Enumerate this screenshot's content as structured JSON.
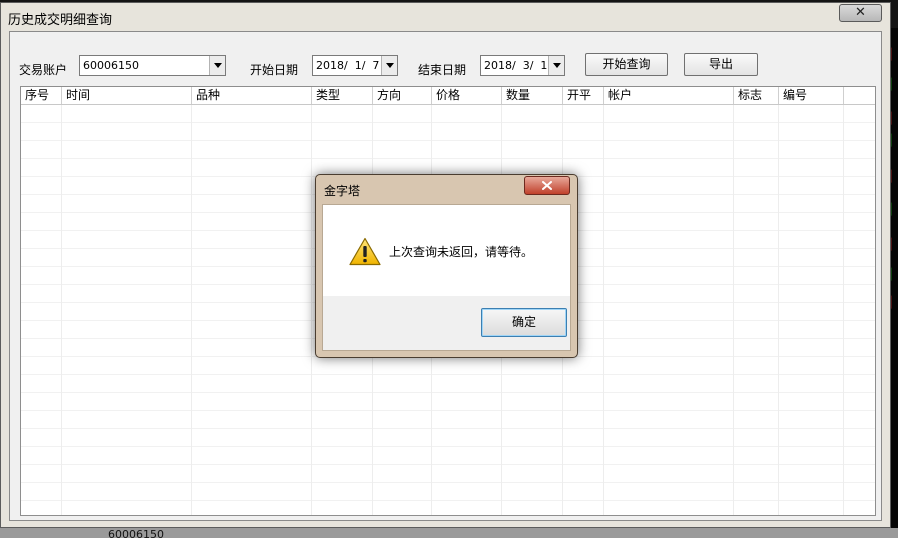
{
  "window": {
    "title": "历史成交明细查询",
    "close_glyph": "✕"
  },
  "toolbar": {
    "account_label": "交易账户",
    "account_value": "60006150",
    "start_label": "开始日期",
    "start_value": "2018/  1/  7",
    "end_label": "结束日期",
    "end_value": "2018/  3/  1",
    "query_button": "开始查询",
    "export_button": "导出"
  },
  "table": {
    "columns": [
      "序号",
      "时间",
      "品种",
      "类型",
      "方向",
      "价格",
      "数量",
      "开平",
      "帐户",
      "标志",
      "编号"
    ]
  },
  "dialog": {
    "title": "金字塔",
    "message": "上次查询未返回，请等待。",
    "ok_label": "确定"
  },
  "background": {
    "bottom_text": "60006150",
    "tick_colors": [
      "#e83030",
      "#20c020"
    ]
  }
}
